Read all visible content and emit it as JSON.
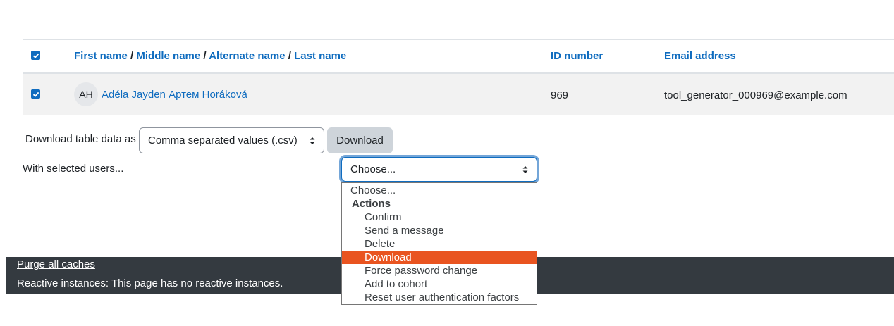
{
  "table": {
    "columns": {
      "name_parts": [
        "First name",
        "Middle name",
        "Alternate name",
        "Last name"
      ],
      "separator": " / ",
      "id_number": "ID number",
      "email": "Email address"
    },
    "rows": [
      {
        "checked": true,
        "initials": "AH",
        "full_name": "Adéla Jayden Артем Horáková",
        "id_number": "969",
        "email": "tool_generator_000969@example.com"
      }
    ]
  },
  "download": {
    "label": "Download table data as",
    "format_selected": "Comma separated values (.csv)",
    "button_label": "Download"
  },
  "bulk": {
    "label": "With selected users...",
    "selected": "Choose...",
    "options": [
      {
        "type": "option",
        "label": "Choose..."
      },
      {
        "type": "group",
        "label": "Actions"
      },
      {
        "type": "child",
        "label": "Confirm"
      },
      {
        "type": "child",
        "label": "Send a message"
      },
      {
        "type": "child",
        "label": "Delete"
      },
      {
        "type": "child",
        "label": "Download",
        "highlighted": true
      },
      {
        "type": "child",
        "label": "Force password change"
      },
      {
        "type": "child",
        "label": "Add to cohort"
      },
      {
        "type": "child",
        "label": "Reset user authentication factors"
      }
    ]
  },
  "footer": {
    "purge_link": "Purge all caches",
    "reactive_text": "Reactive instances: This page has no reactive instances."
  },
  "colors": {
    "link": "#0f6cbf",
    "highlight": "#e95420",
    "footer_bg": "#343a40"
  }
}
